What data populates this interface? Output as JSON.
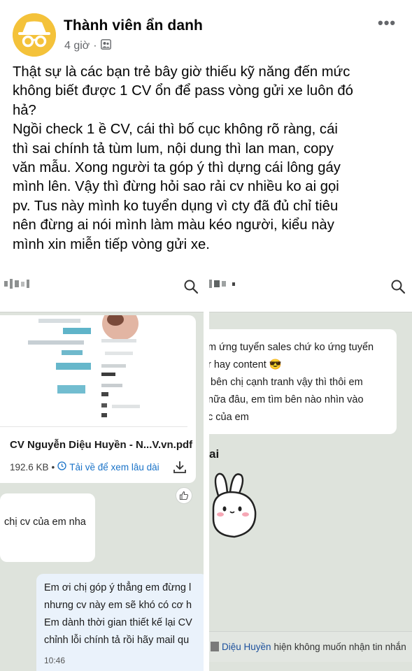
{
  "post": {
    "author": "Thành viên ẩn danh",
    "time": "4 giờ",
    "separator": "·",
    "text": "Thật sự là các bạn trẻ bây giờ thiếu kỹ năng đến mức\nkhông biết được 1 CV ổn để pass vòng gửi xe luôn đó\nhả?\nNgồi check 1 ề CV, cái thì bố cục không rõ ràng, cái\nthì sai chính tả tùm lum, nội dung thì lan man, copy\nvăn mẫu. Xong người ta góp ý thì dựng cái lông gáy\nmình lên. Vậy thì đừng hỏi sao rải cv nhiều ko ai gọi\npv. Tus này mình ko tuyển dụng vì cty đã đủ chỉ tiêu\nnên đừng ai nói mình làm màu kéo người, kiểu này\nmình xin miễn tiếp vòng gửi xe."
  },
  "left_chat": {
    "file_name": "CV Nguyễn Diệu Huyền - N...V.vn.pdf",
    "file_size": "192.6 KB",
    "file_sep": "•",
    "save_link": "Tải về để xem lâu dài",
    "incoming_msg": "chị cv của em nha",
    "outgoing_msg": "Em ơi chị góp ý thẳng em đừng l\nnhưng cv này em sẽ khó có cơ h\nEm dành thời gian thiết kế lại CV\nchỉnh lỗi chính tả rồi hãy mail qu",
    "outgoing_time": "10:46"
  },
  "right_chat": {
    "incoming_msg": "m ứng tuyển sales chứ ko ứng tuyển\nr hay content 😎\n bên chị cạnh tranh vậy thì thôi em\nnữa đâu, em tìm bên nào nhìn vào\nc của em",
    "ai_text": "ai",
    "notice_name": "Diệu Huyền",
    "notice_text": "hiện không muốn nhận tin nhắn"
  },
  "icons": {
    "avatar": "incognito-icon",
    "privacy": "friends-only-icon",
    "more": "more-options-icon",
    "search": "search-icon",
    "download": "download-icon",
    "like": "thumbs-up-icon",
    "clock": "clock-icon"
  }
}
